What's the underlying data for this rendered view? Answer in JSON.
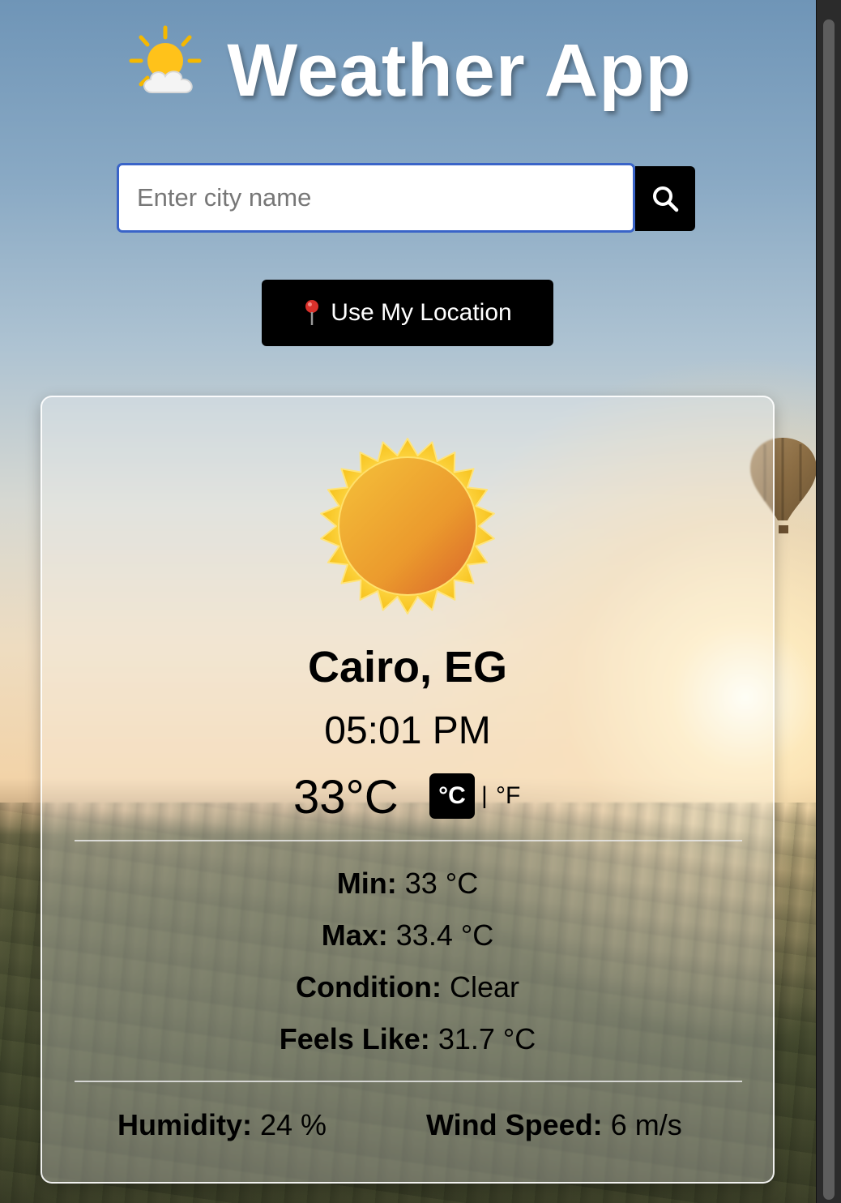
{
  "header": {
    "title": "Weather App",
    "title_icon": "sun-behind-cloud-icon"
  },
  "search": {
    "placeholder": "Enter city name",
    "value": "",
    "button_icon": "search-icon"
  },
  "location_button": {
    "icon": "pin-icon",
    "label": "Use My Location"
  },
  "weather": {
    "icon": "sun-icon",
    "city": "Cairo, EG",
    "time": "05:01 PM",
    "temperature": "33°C",
    "unit_celsius": "°C",
    "unit_separator": "|",
    "unit_fahrenheit": "°F",
    "active_unit": "°C",
    "min_label": "Min:",
    "min_value": "33 °C",
    "max_label": "Max:",
    "max_value": "33.4 °C",
    "condition_label": "Condition:",
    "condition_value": "Clear",
    "feels_like_label": "Feels Like:",
    "feels_like_value": "31.7 °C",
    "humidity_label": "Humidity:",
    "humidity_value": "24 %",
    "wind_label": "Wind Speed:",
    "wind_value": "6 m/s"
  },
  "colors": {
    "button_bg": "#000000",
    "input_focus_border": "#3a64c8",
    "text": "#000000",
    "title_text": "#ffffff"
  }
}
